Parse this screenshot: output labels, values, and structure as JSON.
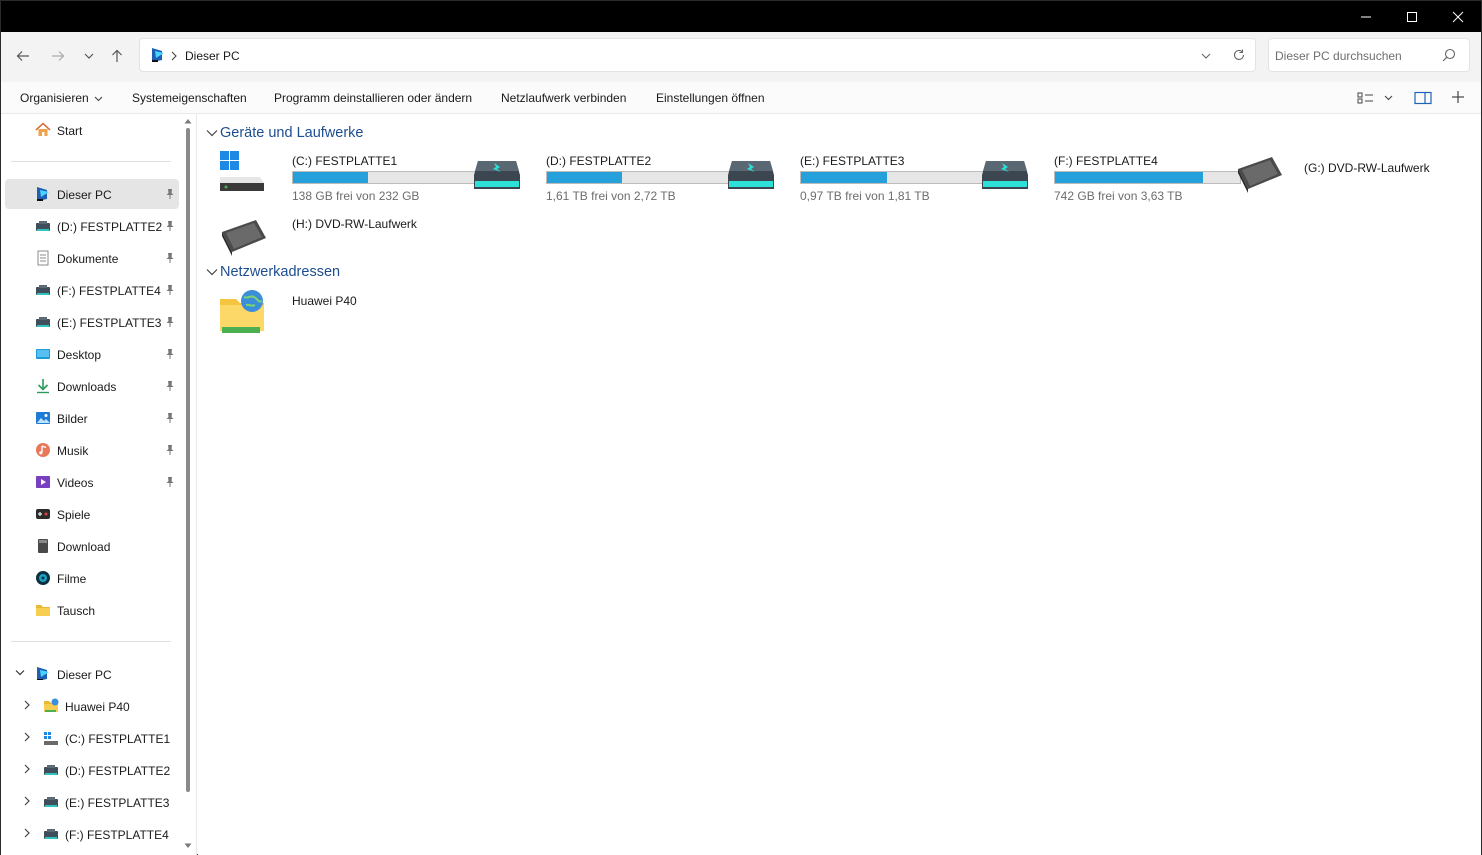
{
  "window": {
    "controls": {
      "minimize": "─",
      "maximize": "☐",
      "close": "✕"
    }
  },
  "address": {
    "path": "Dieser PC",
    "search_placeholder": "Dieser PC durchsuchen"
  },
  "toolbar": {
    "organize": "Organisieren",
    "system_properties": "Systemeigenschaften",
    "uninstall": "Programm deinstallieren oder ändern",
    "map_drive": "Netzlaufwerk verbinden",
    "open_settings": "Einstellungen öffnen"
  },
  "sidebar": {
    "home": "Start",
    "quick": [
      {
        "label": "Dieser PC",
        "icon": "pc-icon",
        "pinned": true
      },
      {
        "label": "(D:) FESTPLATTE2",
        "icon": "drive-icon",
        "pinned": true
      },
      {
        "label": "Dokumente",
        "icon": "document-icon",
        "pinned": true
      },
      {
        "label": "(F:) FESTPLATTE4",
        "icon": "drive-icon",
        "pinned": true
      },
      {
        "label": "(E:) FESTPLATTE3",
        "icon": "drive-icon",
        "pinned": true
      },
      {
        "label": "Desktop",
        "icon": "desktop-icon",
        "pinned": true
      },
      {
        "label": "Downloads",
        "icon": "download-icon",
        "pinned": true
      },
      {
        "label": "Bilder",
        "icon": "pictures-icon",
        "pinned": true
      },
      {
        "label": "Musik",
        "icon": "music-icon",
        "pinned": true
      },
      {
        "label": "Videos",
        "icon": "videos-icon",
        "pinned": true
      },
      {
        "label": "Spiele",
        "icon": "games-icon",
        "pinned": false
      },
      {
        "label": "Download",
        "icon": "folder-dark-icon",
        "pinned": false
      },
      {
        "label": "Filme",
        "icon": "film-icon",
        "pinned": false
      },
      {
        "label": "Tausch",
        "icon": "folder-icon",
        "pinned": false
      }
    ],
    "tree_root": "Dieser PC",
    "tree": [
      {
        "label": "Huawei P40"
      },
      {
        "label": "(C:) FESTPLATTE1"
      },
      {
        "label": "(D:) FESTPLATTE2"
      },
      {
        "label": "(E:) FESTPLATTE3"
      },
      {
        "label": "(F:) FESTPLATTE4"
      }
    ]
  },
  "content": {
    "group_drives": "Geräte und Laufwerke",
    "group_network": "Netzwerkadressen",
    "drives": [
      {
        "name": "(C:) FESTPLATTE1",
        "free": "138 GB frei von 232 GB",
        "used_pct": 40.5,
        "kind": "system"
      },
      {
        "name": "(D:) FESTPLATTE2",
        "free": "1,61 TB frei von 2,72 TB",
        "used_pct": 40.8,
        "kind": "hdd"
      },
      {
        "name": "(E:) FESTPLATTE3",
        "free": "0,97 TB frei von 1,81 TB",
        "used_pct": 46.4,
        "kind": "hdd"
      },
      {
        "name": "(F:) FESTPLATTE4",
        "free": "742 GB frei von 3,63 TB",
        "used_pct": 80.0,
        "kind": "hdd"
      },
      {
        "name": "(G:) DVD-RW-Laufwerk",
        "free": "",
        "used_pct": null,
        "kind": "dvd"
      },
      {
        "name": "(H:) DVD-RW-Laufwerk",
        "free": "",
        "used_pct": null,
        "kind": "dvd"
      }
    ],
    "network": [
      {
        "name": "Huawei P40"
      }
    ]
  },
  "colors": {
    "accent": "#26a0da",
    "header_text": "#1d4e8f",
    "selection": "#e5e5e5"
  }
}
